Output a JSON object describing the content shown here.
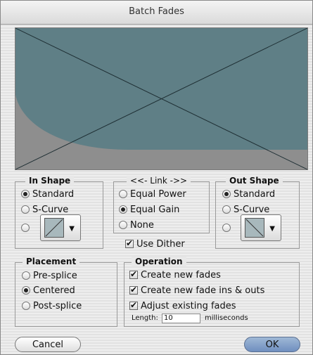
{
  "window": {
    "title": "Batch Fades"
  },
  "preview": {
    "fill_color": "#5f7f86",
    "background_color": "#8e8e8e"
  },
  "in_shape": {
    "label": "In Shape",
    "options": [
      {
        "label": "Standard",
        "selected": true
      },
      {
        "label": "S-Curve",
        "selected": false
      },
      {
        "label": "",
        "selected": false
      }
    ],
    "custom_shape_icon": "fade-in-curve-icon"
  },
  "link": {
    "label": "<<- Link ->>",
    "options": [
      {
        "label": "Equal Power",
        "selected": false
      },
      {
        "label": "Equal Gain",
        "selected": true
      },
      {
        "label": "None",
        "selected": false
      }
    ]
  },
  "use_dither": {
    "label": "Use Dither",
    "checked": true
  },
  "out_shape": {
    "label": "Out Shape",
    "options": [
      {
        "label": "Standard",
        "selected": true
      },
      {
        "label": "S-Curve",
        "selected": false
      },
      {
        "label": "",
        "selected": false
      }
    ],
    "custom_shape_icon": "fade-out-curve-icon"
  },
  "placement": {
    "label": "Placement",
    "options": [
      {
        "label": "Pre-splice",
        "selected": false
      },
      {
        "label": "Centered",
        "selected": true
      },
      {
        "label": "Post-splice",
        "selected": false
      }
    ]
  },
  "operation": {
    "label": "Operation",
    "create_new_fades": {
      "label": "Create new fades",
      "checked": true
    },
    "create_fade_ins_outs": {
      "label": "Create new fade ins & outs",
      "checked": true
    },
    "adjust_existing": {
      "label": "Adjust existing fades",
      "checked": true
    },
    "length_label": "Length:",
    "length_value": "10",
    "length_unit": "milliseconds"
  },
  "buttons": {
    "cancel": "Cancel",
    "ok": "OK"
  },
  "colors": {
    "ok_button": "#7d9cc8",
    "stripe_light": "#eeeeee",
    "stripe_dark": "#e2e2e2"
  }
}
